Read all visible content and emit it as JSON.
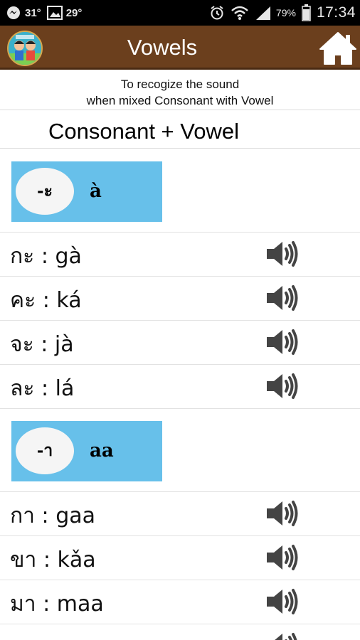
{
  "status_bar": {
    "temp1": "31°",
    "temp2": "29°",
    "battery_pct": "79%",
    "time": "17:34",
    "icons": [
      "messenger-icon",
      "image-icon",
      "alarm-icon",
      "wifi-icon",
      "signal-icon",
      "battery-icon"
    ]
  },
  "app_bar": {
    "title": "Vowels",
    "avatar_icon": "avatar-icon",
    "home_icon": "home-icon",
    "colors": {
      "bar": "#6b3f1d",
      "vowel_box": "#67c0ea"
    }
  },
  "intro": {
    "line1": "To recogize the sound",
    "line2": "when mixed Consonant with Vowel"
  },
  "heading": "Consonant + Vowel",
  "groups": [
    {
      "vowel": "-ะ",
      "roman": "à",
      "rows": [
        {
          "text": "กะ : gà"
        },
        {
          "text": "คะ : ká"
        },
        {
          "text": "จะ : jà"
        },
        {
          "text": "ละ : lá"
        }
      ]
    },
    {
      "vowel": "-า",
      "roman": "aa",
      "rows": [
        {
          "text": "กา : gaa"
        },
        {
          "text": "ขา : kǎa"
        },
        {
          "text": "มา : maa"
        }
      ]
    }
  ]
}
